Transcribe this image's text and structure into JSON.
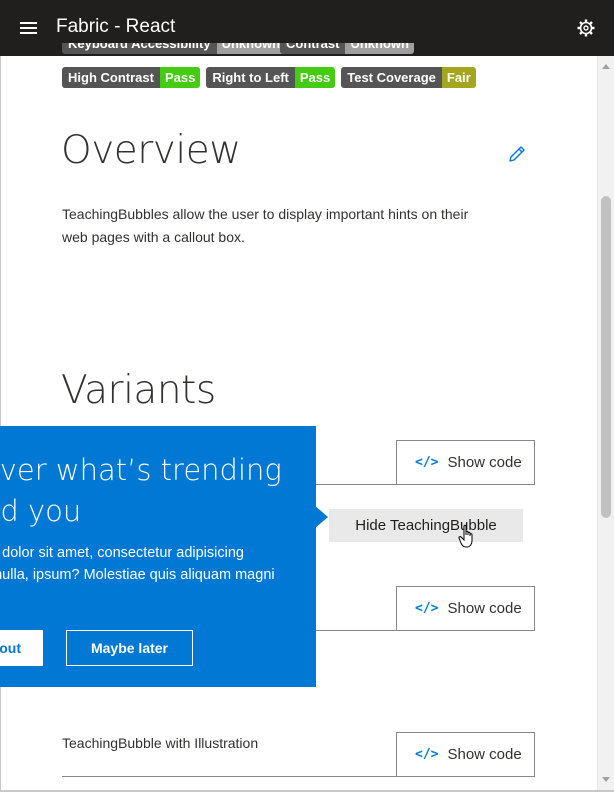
{
  "app": {
    "title": "Fabric - React"
  },
  "badges_top": [
    {
      "label": "Keyboard Accessibility",
      "value": "Unknown"
    },
    {
      "label": "Contrast",
      "value": "Unknown"
    }
  ],
  "badges": [
    {
      "label": "High Contrast",
      "value": "Pass",
      "status": "pass"
    },
    {
      "label": "Right to Left",
      "value": "Pass",
      "status": "pass"
    },
    {
      "label": "Test Coverage",
      "value": "Fair",
      "status": "fair"
    }
  ],
  "overview": {
    "title": "Overview",
    "text": "TeachingBubbles allow the user to display important hints on their web pages with a callout box."
  },
  "variants": {
    "title": "Variants"
  },
  "show_code_label": "Show code",
  "show_code_icon": "</>",
  "hide_button": "Hide TeachingBubble",
  "bubble": {
    "headline": "over what’s trending\nnd you",
    "body": "um dolor sit amet, consectetur adipisicing\ne, nulla, ipsum? Molestiae quis aliquam magni\nn?",
    "primary": "out",
    "secondary": "Maybe later"
  },
  "illustration_label": "TeachingBubble with Illustration",
  "colors": {
    "accent": "#0078d4",
    "topbar": "#201f1e",
    "pass": "#44cc11",
    "fair": "#a4a61d"
  }
}
